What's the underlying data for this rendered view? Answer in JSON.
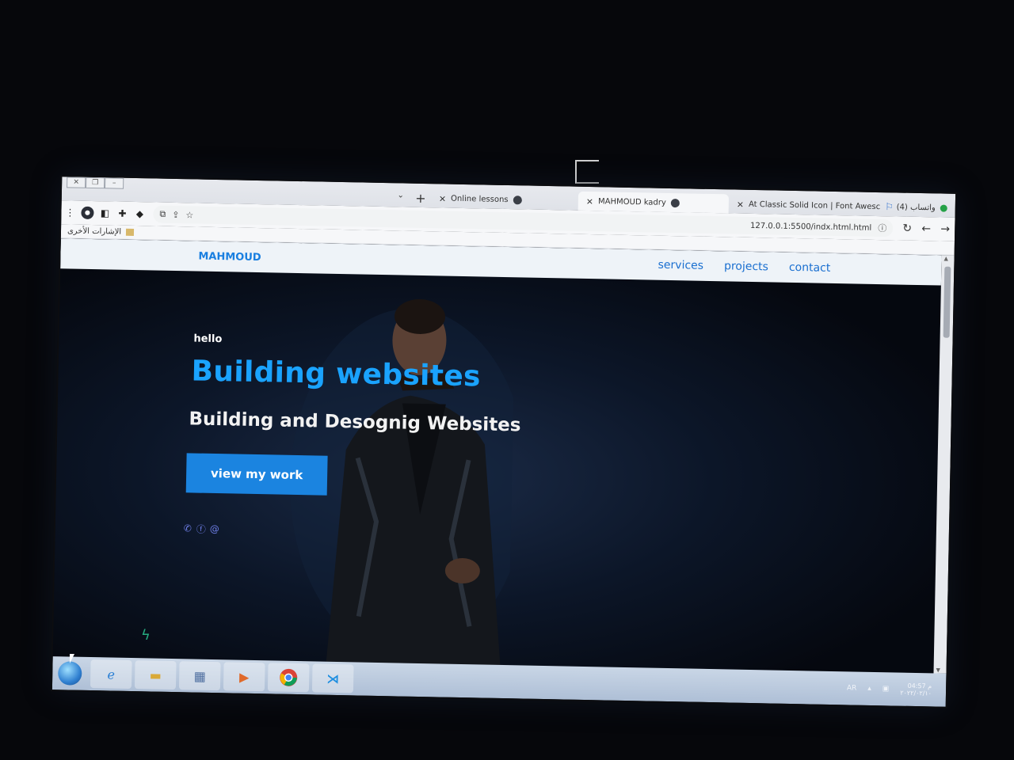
{
  "browser": {
    "tabs": [
      {
        "label": "واتساب (4)",
        "close": "×"
      },
      {
        "label": "At Classic Solid Icon | Font Awesc",
        "close": "×"
      },
      {
        "label": "MAHMOUD kadry",
        "close": "×"
      },
      {
        "label": "Online lessons",
        "close": "×"
      }
    ],
    "new_tab": "+",
    "address": "127.0.0.1:5500/indx.html.html",
    "bookmarks_other": "الإشارات الأخرى"
  },
  "site": {
    "logo": "MAHMOUD",
    "nav": [
      "services",
      "projects",
      "contact"
    ],
    "hero": {
      "greeting": "hello",
      "title": "Building websites",
      "subtitle": "Building and Desognig Websites",
      "cta": "view my work"
    },
    "social_icons": [
      "whatsapp-icon",
      "facebook-icon",
      "at-icon"
    ]
  },
  "taskbar": {
    "items": [
      "internet-explorer-icon",
      "folder-icon",
      "paint-icon",
      "media-player-icon",
      "chrome-icon",
      "vscode-icon"
    ],
    "language": "AR",
    "time": "04:57 م",
    "date": "٢٠٢٢/٠٢/١٠"
  },
  "colors": {
    "accent": "#1aa3ff",
    "button": "#1b84e0",
    "header_bg": "#eef3f8",
    "page_bg": "#06070b"
  }
}
